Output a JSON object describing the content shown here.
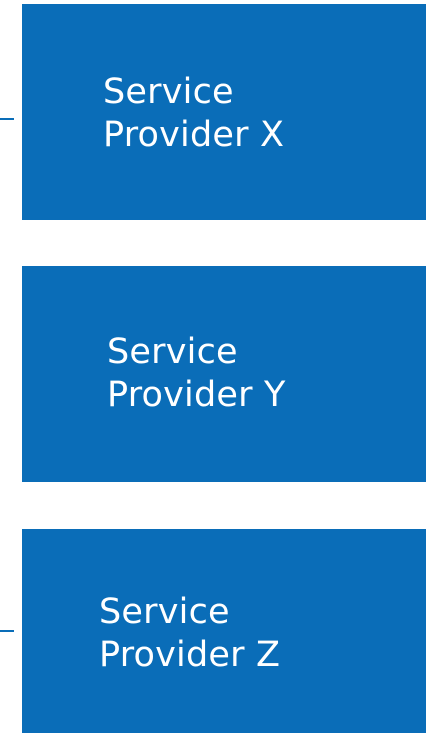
{
  "providers": [
    {
      "line1": "Service",
      "line2": "Provider X"
    },
    {
      "line1": "Service",
      "line2": "Provider Y"
    },
    {
      "line1": "Service",
      "line2": "Provider Z"
    }
  ],
  "colors": {
    "box_fill": "#0a6db8",
    "text": "#ffffff",
    "background": "#ffffff"
  }
}
